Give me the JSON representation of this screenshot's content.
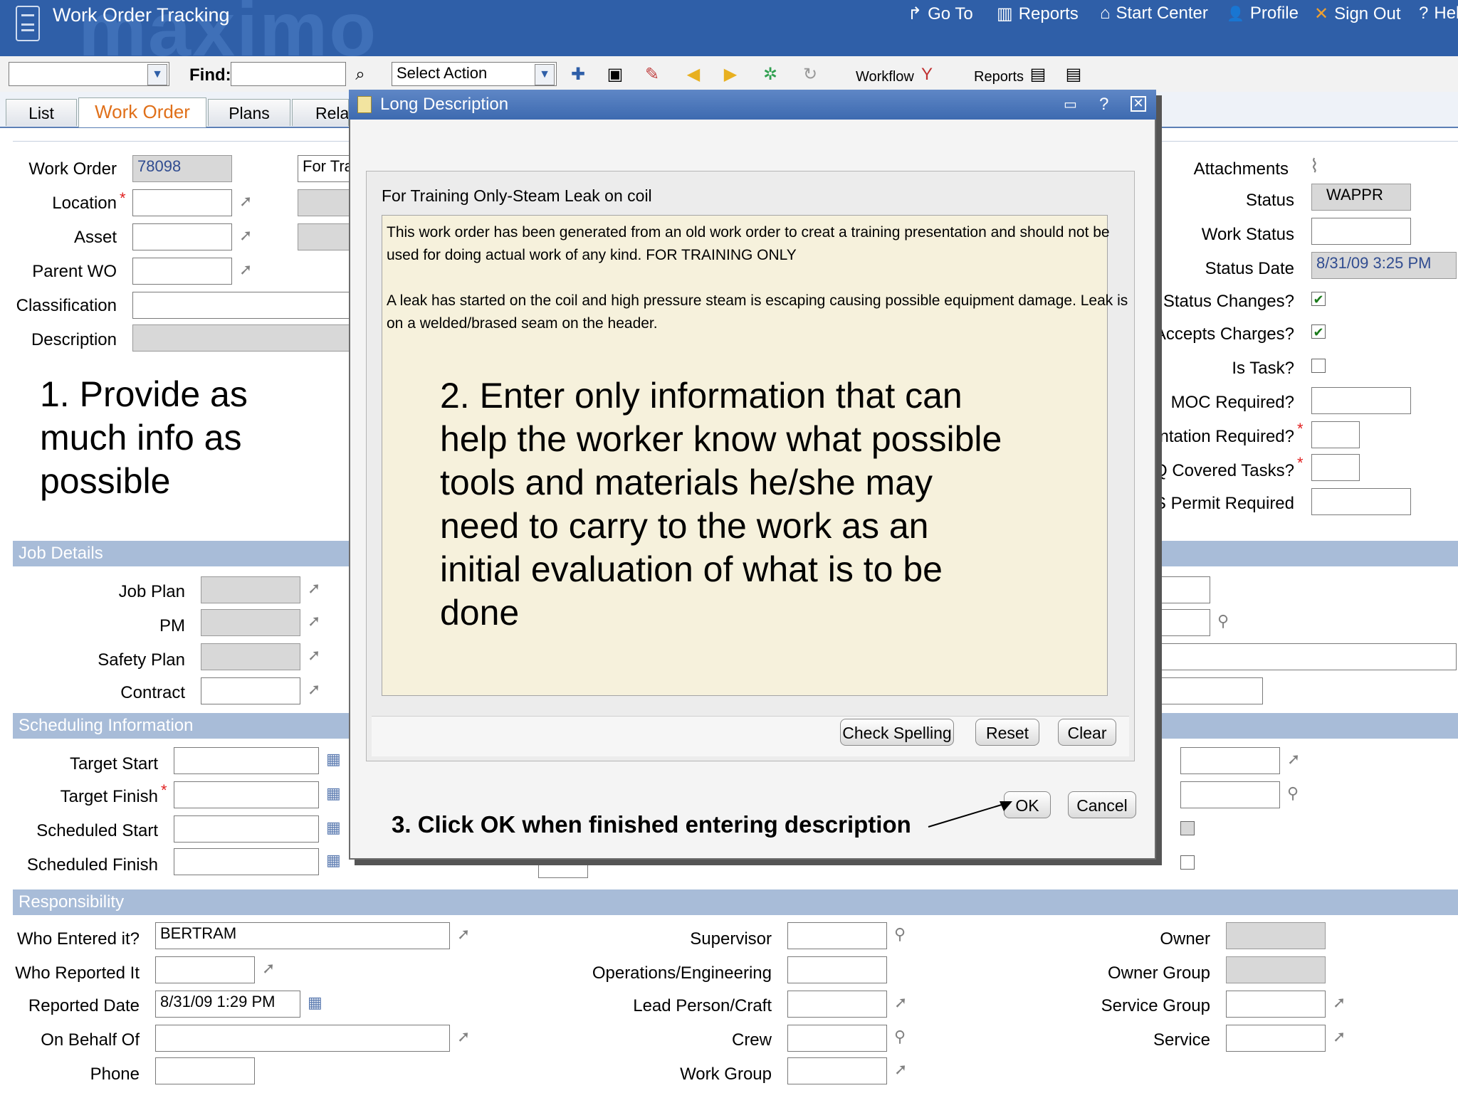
{
  "header": {
    "title": "Work Order Tracking",
    "watermark": "maximo",
    "links": [
      {
        "icon": "go-to-icon",
        "glyph": "↱",
        "label": "Go To"
      },
      {
        "icon": "reports-icon",
        "glyph": "▥",
        "label": "Reports"
      },
      {
        "icon": "home-icon",
        "glyph": "⌂",
        "label": "Start Center"
      },
      {
        "icon": "profile-icon",
        "glyph": "👤",
        "label": "Profile"
      },
      {
        "icon": "sign-out-icon",
        "glyph": "✕",
        "label": "Sign Out"
      },
      {
        "icon": "help-icon",
        "glyph": "?",
        "label": "Hel"
      }
    ]
  },
  "toolbar": {
    "find_label": "Find:",
    "action_select": "Select Action",
    "workflow_label": "Workflow",
    "reports_label": "Reports"
  },
  "tabs": [
    "List",
    "Work Order",
    "Plans",
    "Relat"
  ],
  "active_tab": "Work Order",
  "work_order": {
    "work_order_label": "Work Order",
    "work_order_value": "78098",
    "description_partial": "For Tra",
    "location_label": "Location",
    "asset_label": "Asset",
    "parent_wo_label": "Parent WO",
    "classification_label": "Classification",
    "description_label": "Description"
  },
  "right_panel": {
    "attachments_label": "Attachments",
    "status_label": "Status",
    "status_value": "WAPPR",
    "work_status_label": "Work Status",
    "status_date_label": "Status Date",
    "status_date_value": "8/31/09 3:25 PM",
    "status_changes_label": "it Status Changes?",
    "accepts_charges_label": "Accepts Charges?",
    "is_task_label": "Is Task?",
    "moc_required_label": "MOC Required?",
    "entation_required_label": "entation Required?",
    "covered_tasks_label": "Q Covered Tasks?",
    "permit_required_label": "S Permit Required"
  },
  "annotations": {
    "step1": [
      "1. Provide as",
      "much info as",
      "possible"
    ],
    "step2": [
      "2.  Enter only information that can",
      "help the worker know what possible",
      "tools and materials he/she may",
      "need to carry to the work as an",
      "initial evaluation of what is to be",
      "done"
    ],
    "step3": "3. Click OK when finished entering description"
  },
  "job_details": {
    "title": "Job Details",
    "job_plan_label": "Job Plan",
    "pm_label": "PM",
    "safety_plan_label": "Safety Plan",
    "contract_label": "Contract"
  },
  "scheduling": {
    "title": "Scheduling Information",
    "target_start_label": "Target Start",
    "target_finish_label": "Target Finish",
    "scheduled_start_label": "Scheduled Start",
    "scheduled_finish_label": "Scheduled Finish"
  },
  "responsibility": {
    "title": "Responsibility",
    "who_entered_label": "Who Entered it?",
    "who_entered_value": "BERTRAM",
    "who_reported_label": "Who Reported It",
    "reported_date_label": "Reported Date",
    "reported_date_value": "8/31/09 1:29 PM",
    "on_behalf_label": "On Behalf Of",
    "phone_label": "Phone",
    "supervisor_label": "Supervisor",
    "operations_label": "Operations/Engineering",
    "lead_label": "Lead Person/Craft",
    "crew_label": "Crew",
    "work_group_label": "Work Group",
    "owner_label": "Owner",
    "owner_group_label": "Owner Group",
    "service_group_label": "Service Group",
    "service_label": "Service"
  },
  "modal": {
    "title": "Long Description",
    "summary": "For Training Only-Steam Leak on coil",
    "para1_line1": "This work order has been generated from an old work order to creat a training presentation and should not be",
    "para1_line2": "used for doing actual work of any kind.  FOR TRAINING ONLY",
    "para2_line1": "A leak has started on the coil and high pressure steam is escaping causing possible equipment damage.  Leak is",
    "para2_line2": "on a welded/brased seam on the header.",
    "check_spelling": "Check Spelling",
    "reset": "Reset",
    "clear": "Clear",
    "ok": "OK",
    "cancel": "Cancel"
  },
  "colors": {
    "header_blue": "#2f5fa8",
    "section_blue": "#a8bcd8",
    "active_tab": "#e0701a",
    "required": "#e02020",
    "description_bg": "#f6f1dc"
  }
}
